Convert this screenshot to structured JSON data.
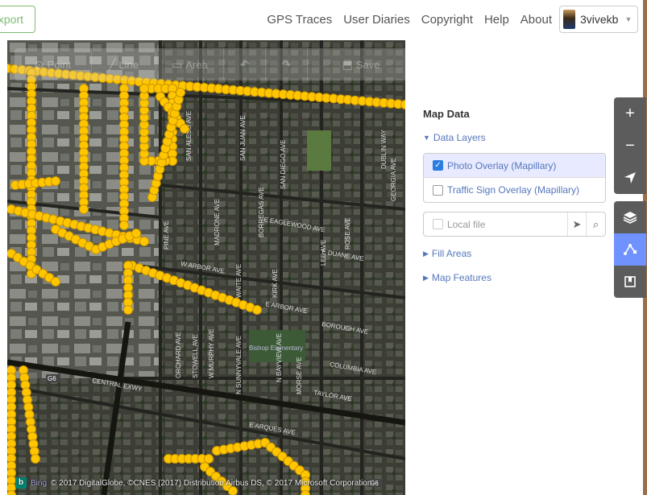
{
  "topbar": {
    "export_label": "xport",
    "nav": [
      "GPS Traces",
      "User Diaries",
      "Copyright",
      "Help",
      "About"
    ],
    "username": "3vivekb"
  },
  "editor_toolbar": {
    "buttons": [
      {
        "label": "Point",
        "icon": "map-marker-icon"
      },
      {
        "label": "Line",
        "icon": "line-icon"
      },
      {
        "label": "Area",
        "icon": "area-icon"
      },
      {
        "label": "",
        "icon": "undo-icon"
      },
      {
        "label": "",
        "icon": "redo-icon"
      },
      {
        "label": "Save",
        "icon": "save-icon"
      }
    ]
  },
  "map": {
    "street_labels": [
      "SAN ALESO AVE",
      "SAN JUAN AVE",
      "SAN DIEGO AVE",
      "DUBLIN WAY",
      "GEORGIA AVE",
      "BORREGAS AVE",
      "MADRONE AVE",
      "PINE AVE",
      "E EAGLEWOOD AVE",
      "E DUANE AVE",
      "W ARBOR AVE",
      "WAITE AVE",
      "KIRK AVE",
      "LEE AVE",
      "ROSE AVE",
      "E ARBOR AVE",
      "BOROUGH AVE",
      "ORCHARD AVE",
      "STOWELL AVE",
      "W MURPHY AVE",
      "N SUNNYVALE AVE",
      "N BAYVIEW AVE",
      "MORSE AVE",
      "COLUMBIA AVE",
      "TAYLOR AVE",
      "CENTRAL EXWY",
      "E ARQUES AVE",
      "G6",
      "Bishop Elementary"
    ],
    "attribution_brand": "Bing",
    "attribution": "© 2017 DigitalGlobe, ©CNES (2017) Distribution Airbus DS, © 2017 Microsoft Corporation"
  },
  "panel": {
    "title": "Map Data",
    "data_layers_label": "Data Layers",
    "layers": [
      {
        "label": "Photo Overlay (Mapillary)",
        "checked": true
      },
      {
        "label": "Traffic Sign Overlay (Mapillary)",
        "checked": false
      }
    ],
    "local_file_label": "Local file",
    "fill_areas_label": "Fill Areas",
    "map_features_label": "Map Features"
  },
  "controls": {
    "zoom_in": "+",
    "zoom_out": "−"
  },
  "colors": {
    "accent": "#7092ff",
    "link": "#5577bb",
    "mapillary_dot": "#ffc600",
    "export_green": "#7ebc6f"
  }
}
